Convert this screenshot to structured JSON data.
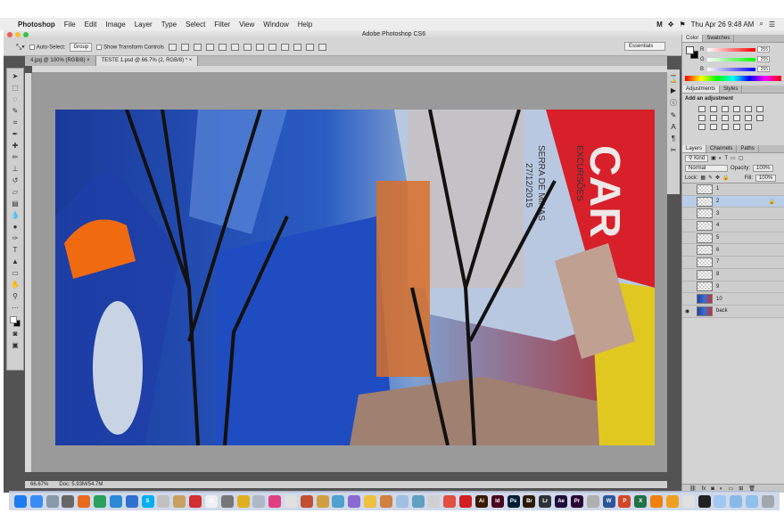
{
  "menubar": {
    "app": "Photoshop",
    "items": [
      "File",
      "Edit",
      "Image",
      "Layer",
      "Type",
      "Select",
      "Filter",
      "View",
      "Window",
      "Help"
    ],
    "clock": "Thu Apr 26  9:48 AM"
  },
  "window": {
    "title": "Adobe Photoshop CS6"
  },
  "options": {
    "auto_select_label": "Auto-Select:",
    "auto_select_value": "Group",
    "transform_label": "Show Transform Controls",
    "workspace": "Essentials"
  },
  "doc_tabs": [
    {
      "label": "4.jpg @ 100% (RGB/8) ×"
    },
    {
      "label": "TESTE 1.psd @ 66.7% (2, RGB/8) * ×"
    }
  ],
  "status": {
    "zoom": "66.67%",
    "doc": "Doc: 5.93M/54.7M"
  },
  "color_panel": {
    "tabs": [
      "Color",
      "Swatches"
    ],
    "channels": [
      {
        "label": "R",
        "value": "255",
        "gradient": "#ff0000"
      },
      {
        "label": "G",
        "value": "255",
        "gradient": "#00ff00"
      },
      {
        "label": "B",
        "value": "255",
        "gradient": "#0000ff"
      }
    ]
  },
  "adjustments_panel": {
    "tabs": [
      "Adjustments",
      "Styles"
    ],
    "title": "Add an adjustment"
  },
  "layers_panel": {
    "tabs": [
      "Layers",
      "Channels",
      "Paths"
    ],
    "filter": "Kind",
    "blend_mode": "Normal",
    "opacity_label": "Opacity:",
    "opacity_value": "100%",
    "lock_label": "Lock:",
    "fill_label": "Fill:",
    "fill_value": "100%",
    "layers": [
      {
        "name": "1",
        "selected": false
      },
      {
        "name": "2",
        "selected": true
      },
      {
        "name": "3",
        "selected": false
      },
      {
        "name": "4",
        "selected": false
      },
      {
        "name": "5",
        "selected": false
      },
      {
        "name": "6",
        "selected": false
      },
      {
        "name": "7",
        "selected": false
      },
      {
        "name": "8",
        "selected": false
      },
      {
        "name": "9",
        "selected": false
      },
      {
        "name": "10",
        "selected": false
      },
      {
        "name": "back",
        "selected": false
      }
    ]
  },
  "artwork": {
    "poster_text": [
      "CAR",
      "EXCURSÕES",
      "SERRA DE MINAS",
      "27/12/2015"
    ]
  },
  "dock": {
    "apps": [
      {
        "label": "",
        "color": "#1c7cf0"
      },
      {
        "label": "",
        "color": "#3a8cf5"
      },
      {
        "label": "",
        "color": "#8899aa"
      },
      {
        "label": "",
        "color": "#666"
      },
      {
        "label": "",
        "color": "#e86a1c"
      },
      {
        "label": "",
        "color": "#2aa05a"
      },
      {
        "label": "",
        "color": "#2a8ad8"
      },
      {
        "label": "",
        "color": "#3070d0"
      },
      {
        "label": "S",
        "color": "#00aff0"
      },
      {
        "label": "",
        "color": "#c0c0c0"
      },
      {
        "label": "",
        "color": "#c8a060"
      },
      {
        "label": "",
        "color": "#d03030"
      },
      {
        "label": "26",
        "color": "#f0f0f0"
      },
      {
        "label": "",
        "color": "#777"
      },
      {
        "label": "",
        "color": "#e0b020"
      },
      {
        "label": "",
        "color": "#b0b8c8"
      },
      {
        "label": "",
        "color": "#e04080"
      },
      {
        "label": "",
        "color": "#e0e0e0"
      },
      {
        "label": "",
        "color": "#c05030"
      },
      {
        "label": "",
        "color": "#d0a040"
      },
      {
        "label": "",
        "color": "#50a0d0"
      },
      {
        "label": "",
        "color": "#8a6ad0"
      },
      {
        "label": "",
        "color": "#f0c040"
      },
      {
        "label": "",
        "color": "#d08040"
      },
      {
        "label": "",
        "color": "#a0c0e0"
      },
      {
        "label": "",
        "color": "#60a0c0"
      },
      {
        "label": "",
        "color": "#d0d0d0"
      },
      {
        "label": "",
        "color": "#e05040"
      },
      {
        "label": "",
        "color": "#d02020"
      },
      {
        "label": "Ai",
        "color": "#3a1800"
      },
      {
        "label": "Id",
        "color": "#49021f"
      },
      {
        "label": "Ps",
        "color": "#001d34"
      },
      {
        "label": "Br",
        "color": "#2a1a04"
      },
      {
        "label": "Lr",
        "color": "#2d3339"
      },
      {
        "label": "Ae",
        "color": "#1e0e3a"
      },
      {
        "label": "Pr",
        "color": "#2a0634"
      },
      {
        "label": "",
        "color": "#b0b0b0"
      },
      {
        "label": "W",
        "color": "#2b579a"
      },
      {
        "label": "P",
        "color": "#d24726"
      },
      {
        "label": "X",
        "color": "#207245"
      },
      {
        "label": "",
        "color": "#f08010"
      },
      {
        "label": "",
        "color": "#f0a020"
      },
      {
        "label": "",
        "color": "#e0e0e0"
      },
      {
        "label": "",
        "color": "#222"
      },
      {
        "label": "",
        "color": "#a0c8f0"
      },
      {
        "label": "",
        "color": "#8ab8e8"
      },
      {
        "label": "",
        "color": "#90c0ec"
      },
      {
        "label": "",
        "color": "#a0a8b0"
      }
    ]
  }
}
